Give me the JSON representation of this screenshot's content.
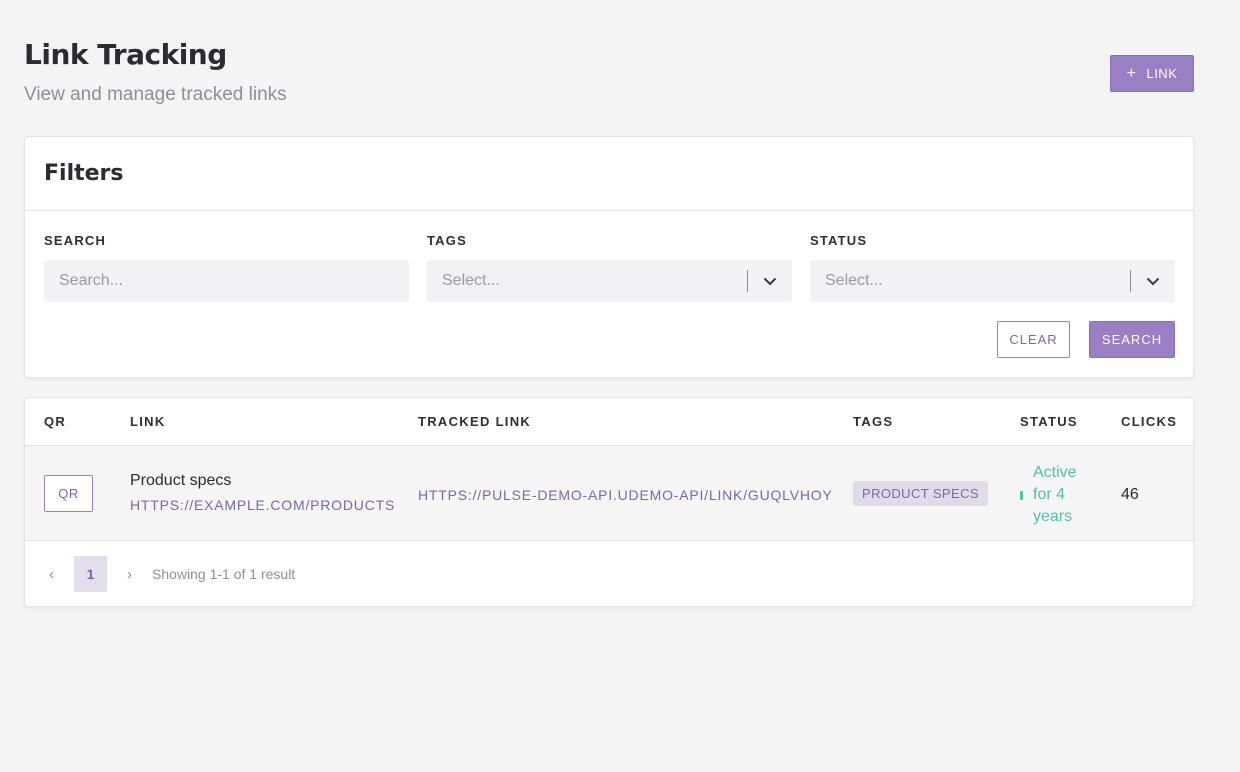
{
  "header": {
    "title": "Link Tracking",
    "subtitle": "View and manage tracked links",
    "add_button_icon": "plus-icon",
    "add_button_label": "LINK"
  },
  "filters": {
    "title": "Filters",
    "search": {
      "label": "SEARCH",
      "placeholder": "Search..."
    },
    "tags": {
      "label": "TAGS",
      "placeholder": "Select...",
      "icon": "chevron-down-icon"
    },
    "status": {
      "label": "STATUS",
      "placeholder": "Select...",
      "icon": "chevron-down-icon"
    },
    "clear_label": "CLEAR",
    "search_label": "SEARCH"
  },
  "table": {
    "columns": [
      "QR",
      "LINK",
      "TRACKED LINK",
      "TAGS",
      "STATUS",
      "CLICKS"
    ],
    "rows": [
      {
        "qr_label": "QR",
        "link_name": "Product specs",
        "link_url": "HTTPS://EXAMPLE.COM/PRODUCTS",
        "tracked_url": "HTTPS://PULSE-DEMO-API.UDEMO-API/LINK/GUQLVHOY",
        "tag": "PRODUCT SPECS",
        "status": "Active for 4 years",
        "clicks": "46"
      }
    ]
  },
  "pagination": {
    "prev_icon": "chevron-left-icon",
    "next_icon": "chevron-right-icon",
    "current_page": "1",
    "info": "Showing 1-1 of 1 result"
  },
  "colors": {
    "accent": "#9b7fc4",
    "accent_text": "#7d66a8",
    "status_active": "#4fbfa8",
    "background": "#f4f4f5"
  }
}
